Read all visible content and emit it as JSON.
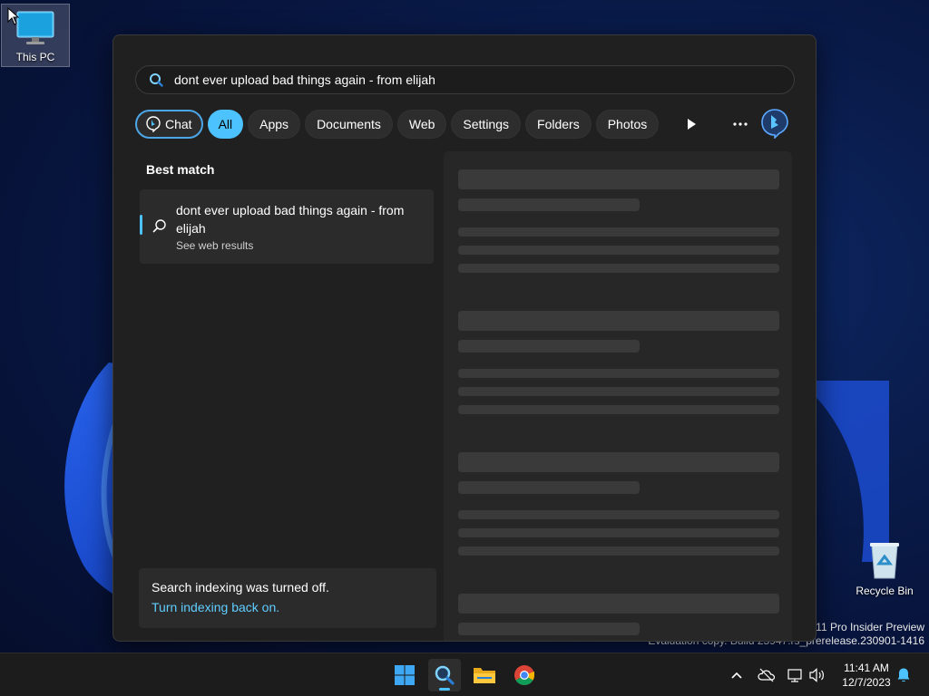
{
  "desktop": {
    "icons": [
      {
        "label": "This PC"
      },
      {
        "label": "Recycle Bin"
      }
    ],
    "watermark": {
      "line1": "s 11 Pro Insider Preview",
      "line2": "Evaluation copy. Build 25947.rs_prerelease.230901-1416"
    }
  },
  "search": {
    "query": "dont ever upload bad things again - from elijah ",
    "filters": [
      "Chat",
      "All",
      "Apps",
      "Documents",
      "Web",
      "Settings",
      "Folders",
      "Photos"
    ],
    "active_filter": "All",
    "best_match_title": "Best match",
    "best_match": {
      "title": "dont ever upload bad things again - from elijah",
      "subtitle": "See web results"
    },
    "indexing": {
      "message": "Search indexing was turned off.",
      "link": "Turn indexing back on."
    }
  },
  "taskbar": {
    "time": "11:41 AM",
    "date": "12/7/2023"
  },
  "colors": {
    "accent": "#4cc2ff",
    "link": "#60cdff",
    "panel_bg": "#202020"
  }
}
